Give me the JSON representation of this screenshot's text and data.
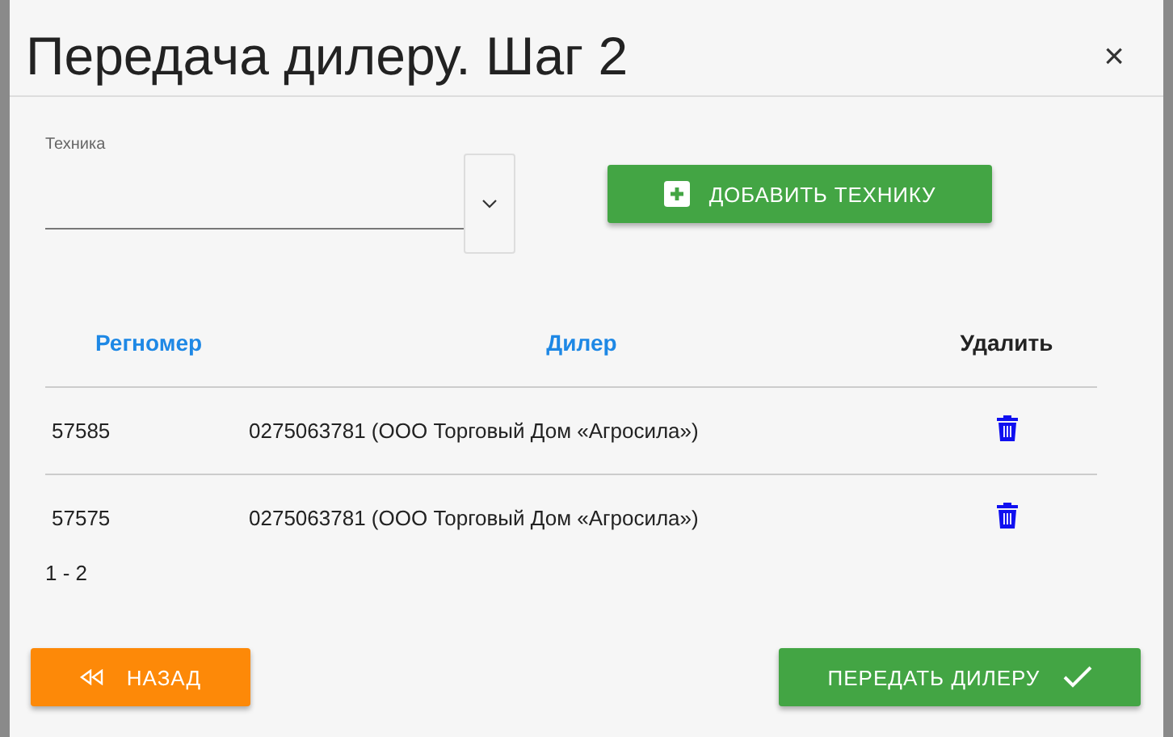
{
  "dialog": {
    "title": "Передача дилеру. Шаг 2",
    "close": "×"
  },
  "field": {
    "label": "Техника"
  },
  "add_button": {
    "label": "ДОБАВИТЬ ТЕХНИКУ"
  },
  "table": {
    "columns": [
      {
        "label": "Регномер",
        "kind": "sortable"
      },
      {
        "label": "Дилер",
        "kind": "sortable"
      },
      {
        "label": "Удалить",
        "kind": "plain"
      }
    ],
    "rows": [
      {
        "regnomer": "57585",
        "dealer": "0275063781 (ООО Торговый Дом «Агросила»)"
      },
      {
        "regnomer": "57575",
        "dealer": "0275063781 (ООО Торговый Дом «Агросила»)"
      }
    ]
  },
  "pagination": "1 - 2",
  "back_button": {
    "label": "НАЗАД"
  },
  "submit_button": {
    "label": "ПЕРЕДАТЬ ДИЛЕРУ"
  }
}
